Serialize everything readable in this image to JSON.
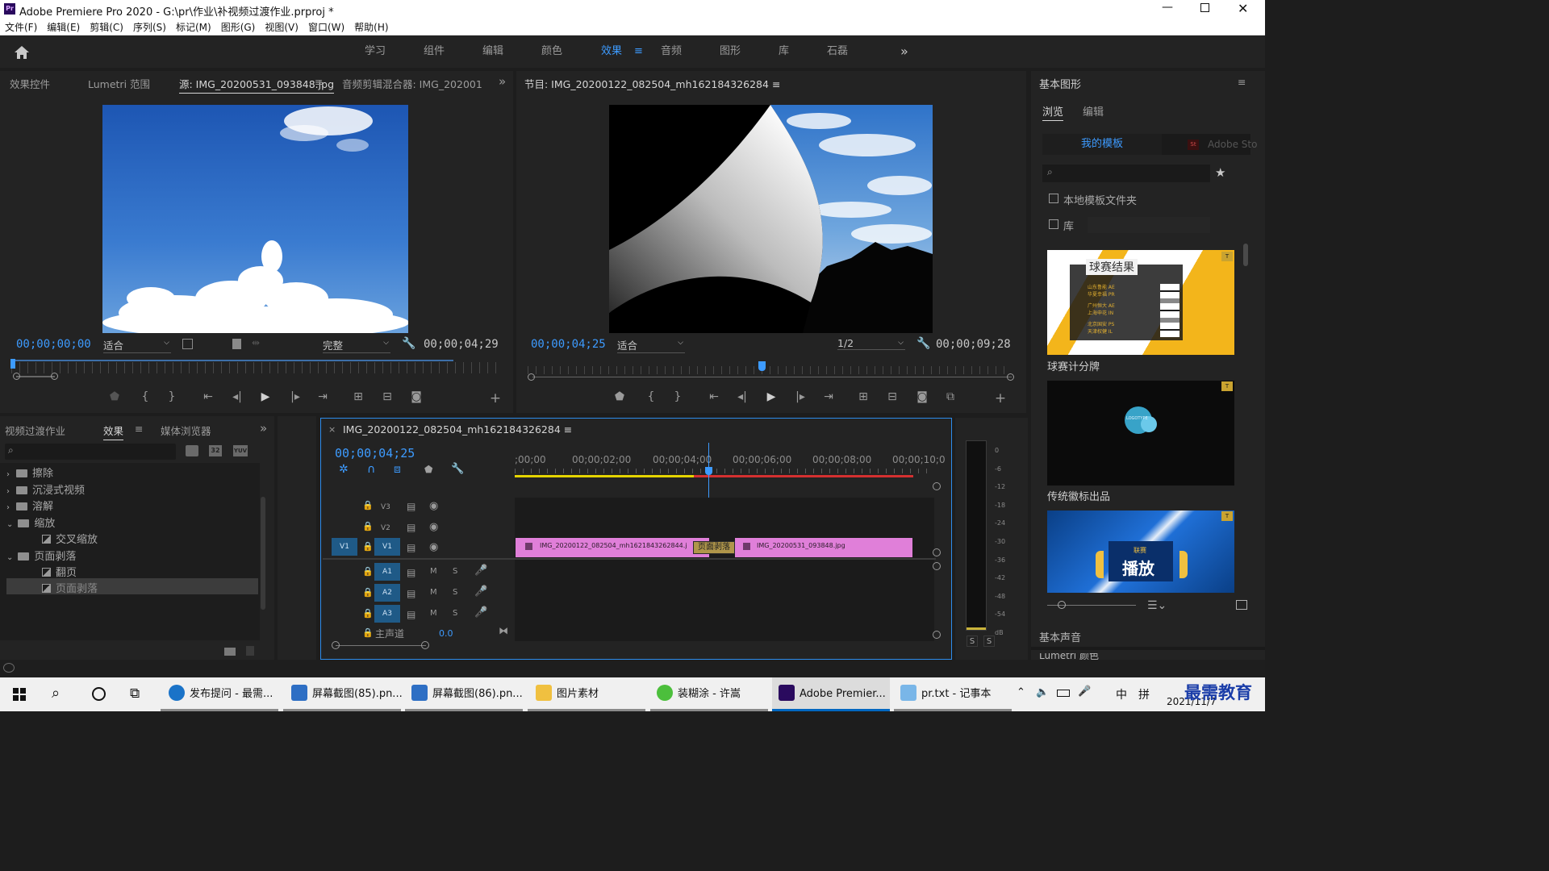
{
  "window": {
    "title": "Adobe Premiere Pro 2020 - G:\\pr\\作业\\补视频过渡作业.prproj *",
    "app_icon": "Pr"
  },
  "menu": [
    "文件(F)",
    "编辑(E)",
    "剪辑(C)",
    "序列(S)",
    "标记(M)",
    "图形(G)",
    "视图(V)",
    "窗口(W)",
    "帮助(H)"
  ],
  "workspaces": {
    "items": [
      "学习",
      "组件",
      "编辑",
      "颜色",
      "效果",
      "音频",
      "图形",
      "库",
      "石磊"
    ],
    "active": "效果",
    "more": "»"
  },
  "source_panel": {
    "tabs": [
      "效果控件",
      "Lumetri 范围",
      "源: IMG_20200531_093848.jpg",
      "音频剪辑混合器: IMG_202001"
    ],
    "active_tab": "源: IMG_20200531_093848.jpg",
    "timecode": "00;00;00;00",
    "fit": "适合",
    "quality": "完整",
    "duration": "00;00;04;29"
  },
  "program_panel": {
    "title": "节目: IMG_20200122_082504_mh162184326284",
    "timecode": "00;00;04;25",
    "fit": "适合",
    "resolution": "1/2",
    "duration": "00;00;09;28"
  },
  "effects_panel": {
    "tabs": [
      "视频过渡作业",
      "效果",
      "媒体浏览器"
    ],
    "active_tab": "效果",
    "tree": [
      {
        "label": "擦除",
        "type": "folder",
        "expanded": false,
        "level": 0
      },
      {
        "label": "沉浸式视频",
        "type": "folder",
        "expanded": false,
        "level": 0
      },
      {
        "label": "溶解",
        "type": "folder",
        "expanded": false,
        "level": 0
      },
      {
        "label": "缩放",
        "type": "folder",
        "expanded": true,
        "level": 0
      },
      {
        "label": "交叉缩放",
        "type": "fx",
        "level": 1
      },
      {
        "label": "页面剥落",
        "type": "folder",
        "expanded": true,
        "level": 0
      },
      {
        "label": "翻页",
        "type": "fx",
        "level": 1
      },
      {
        "label": "页面剥落",
        "type": "fx",
        "level": 1,
        "selected": true
      }
    ]
  },
  "timeline": {
    "sequence_name": "IMG_20200122_082504_mh162184326284",
    "timecode": "00;00;04;25",
    "ruler": [
      ";00;00",
      "00;00;02;00",
      "00;00;04;00",
      "00;00;06;00",
      "00;00;08;00",
      "00;00;10;0"
    ],
    "tracks": {
      "video": [
        "V3",
        "V2",
        "V1"
      ],
      "audio": [
        "A1",
        "A2",
        "A3"
      ],
      "source_patch": "V1",
      "master": "主声道",
      "master_value": "0.0",
      "mute": "M",
      "solo": "S"
    },
    "clips": [
      {
        "name": "IMG_20200122_082504_mh1621843262844.j",
        "track": "V1"
      },
      {
        "name": "IMG_20200531_093848.jpg",
        "track": "V1"
      }
    ],
    "transition": "页面剥落"
  },
  "meter": {
    "scale": [
      "0",
      "-6",
      "-12",
      "-18",
      "-24",
      "-30",
      "-36",
      "-42",
      "-48",
      "-54",
      "dB"
    ],
    "solo_left": "S",
    "solo_right": "S"
  },
  "essential_graphics": {
    "title": "基本图形",
    "tabs": [
      "浏览",
      "编辑"
    ],
    "active_tab": "浏览",
    "sources": [
      "我的模板",
      "Adobe Sto"
    ],
    "checkboxes": [
      "本地模板文件夹",
      "库"
    ],
    "templates": [
      {
        "name": "球赛计分牌",
        "thumb_title": "球赛结果",
        "rows": [
          "山东鲁能 AE",
          "华夏幸福 PR",
          "广州恒大 AE",
          "上海申花 IN",
          "北京国安 PS",
          "天津权健 IL"
        ]
      },
      {
        "name": "传统徽标出品",
        "thumb_text": "LOGOTYPE"
      },
      {
        "name": "",
        "thumb_title": "播放",
        "thumb_sub": "联赛"
      }
    ],
    "basic_sound": "基本声音",
    "next_panel": "Lumetri 颜色"
  },
  "taskbar": {
    "items": [
      {
        "label": "发布提问 - 最需...",
        "icon_color": "#1a73c8"
      },
      {
        "label": "屏幕截图(85).pn...",
        "icon_color": "#2e6fc4"
      },
      {
        "label": "屏幕截图(86).pn...",
        "icon_color": "#2e6fc4"
      },
      {
        "label": "图片素材",
        "icon_color": "#f0c040"
      },
      {
        "label": "装糊涂 - 许嵩",
        "icon_color": "#4cbf3c"
      },
      {
        "label": "Adobe Premier...",
        "icon_color": "#2a0a5e"
      },
      {
        "label": "pr.txt - 记事本",
        "icon_color": "#79b6e8"
      }
    ],
    "ime": "中",
    "ime2": "拼",
    "date": "2021/11/7",
    "watermark": "最需教育"
  }
}
